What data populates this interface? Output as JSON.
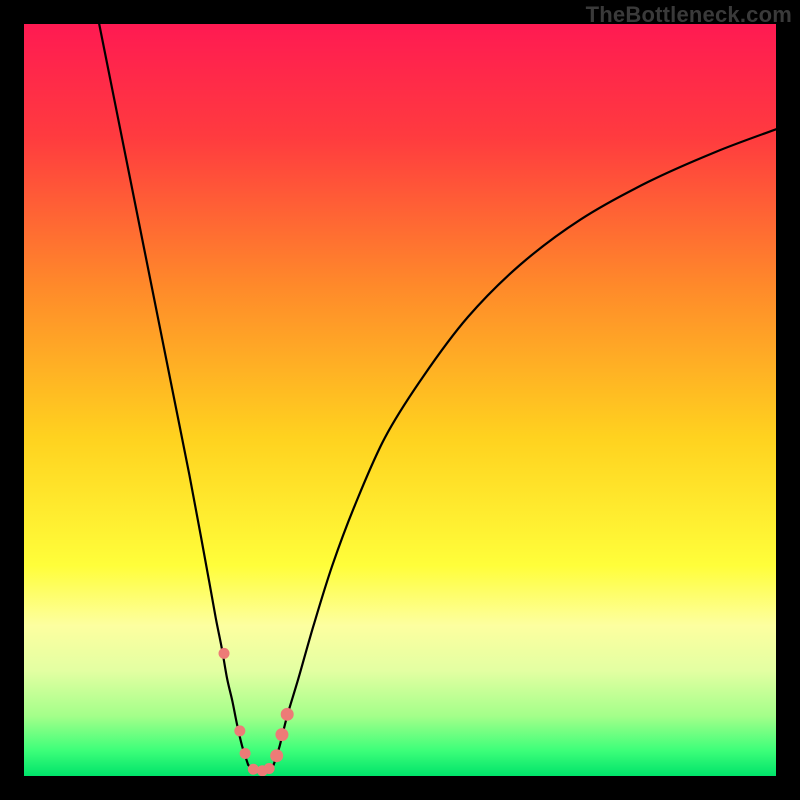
{
  "watermark": "TheBottleneck.com",
  "chart_data": {
    "type": "line",
    "title": "",
    "xlabel": "",
    "ylabel": "",
    "xlim": [
      0,
      100
    ],
    "ylim": [
      0,
      100
    ],
    "grid": false,
    "legend": false,
    "gradient_stops": [
      {
        "offset": 0.0,
        "color": "#ff1a52"
      },
      {
        "offset": 0.15,
        "color": "#ff3b3f"
      },
      {
        "offset": 0.35,
        "color": "#ff8a2a"
      },
      {
        "offset": 0.55,
        "color": "#ffd21f"
      },
      {
        "offset": 0.72,
        "color": "#fffe3a"
      },
      {
        "offset": 0.8,
        "color": "#fdffa0"
      },
      {
        "offset": 0.86,
        "color": "#e3ffa2"
      },
      {
        "offset": 0.92,
        "color": "#a4ff8a"
      },
      {
        "offset": 0.965,
        "color": "#3fff7a"
      },
      {
        "offset": 1.0,
        "color": "#00e36a"
      }
    ],
    "series": [
      {
        "name": "left-branch",
        "x": [
          10,
          12,
          14,
          16,
          18,
          20,
          22,
          23.5,
          24.6,
          25.5,
          26.3,
          27.0,
          27.7,
          28.3,
          29.0,
          29.8
        ],
        "y": [
          100,
          90,
          80,
          70,
          60,
          50,
          40,
          32,
          26,
          21,
          17,
          13,
          10,
          7,
          4,
          1.5
        ]
      },
      {
        "name": "right-branch",
        "x": [
          33.2,
          34.0,
          35.0,
          36.5,
          38.5,
          41.0,
          44.0,
          48.0,
          53.0,
          59.0,
          66.0,
          74.0,
          83.0,
          92.0,
          100.0
        ],
        "y": [
          1.5,
          4,
          8,
          13,
          20,
          28,
          36,
          45,
          53,
          61,
          68,
          74,
          79,
          83,
          86
        ]
      },
      {
        "name": "valley-floor",
        "x": [
          29.8,
          30.5,
          31.5,
          32.3,
          33.2
        ],
        "y": [
          1.5,
          0.8,
          0.6,
          0.8,
          1.5
        ]
      }
    ],
    "markers": [
      {
        "name": "left-high",
        "x": 26.6,
        "y": 16.3,
        "r": 5.5
      },
      {
        "name": "left-mid",
        "x": 28.7,
        "y": 6.0,
        "r": 5.5
      },
      {
        "name": "left-low",
        "x": 29.4,
        "y": 3.0,
        "r": 5.5
      },
      {
        "name": "floor-a",
        "x": 30.5,
        "y": 0.9,
        "r": 5.5
      },
      {
        "name": "floor-b",
        "x": 31.7,
        "y": 0.7,
        "r": 5.5
      },
      {
        "name": "floor-c",
        "x": 32.6,
        "y": 1.0,
        "r": 5.5
      },
      {
        "name": "right-low",
        "x": 33.6,
        "y": 2.7,
        "r": 6.5
      },
      {
        "name": "right-mid",
        "x": 34.3,
        "y": 5.5,
        "r": 6.5
      },
      {
        "name": "right-high",
        "x": 35.0,
        "y": 8.2,
        "r": 6.5
      }
    ],
    "marker_color": "#ed7b77",
    "curve_color": "#000000",
    "curve_width": 2.2
  }
}
